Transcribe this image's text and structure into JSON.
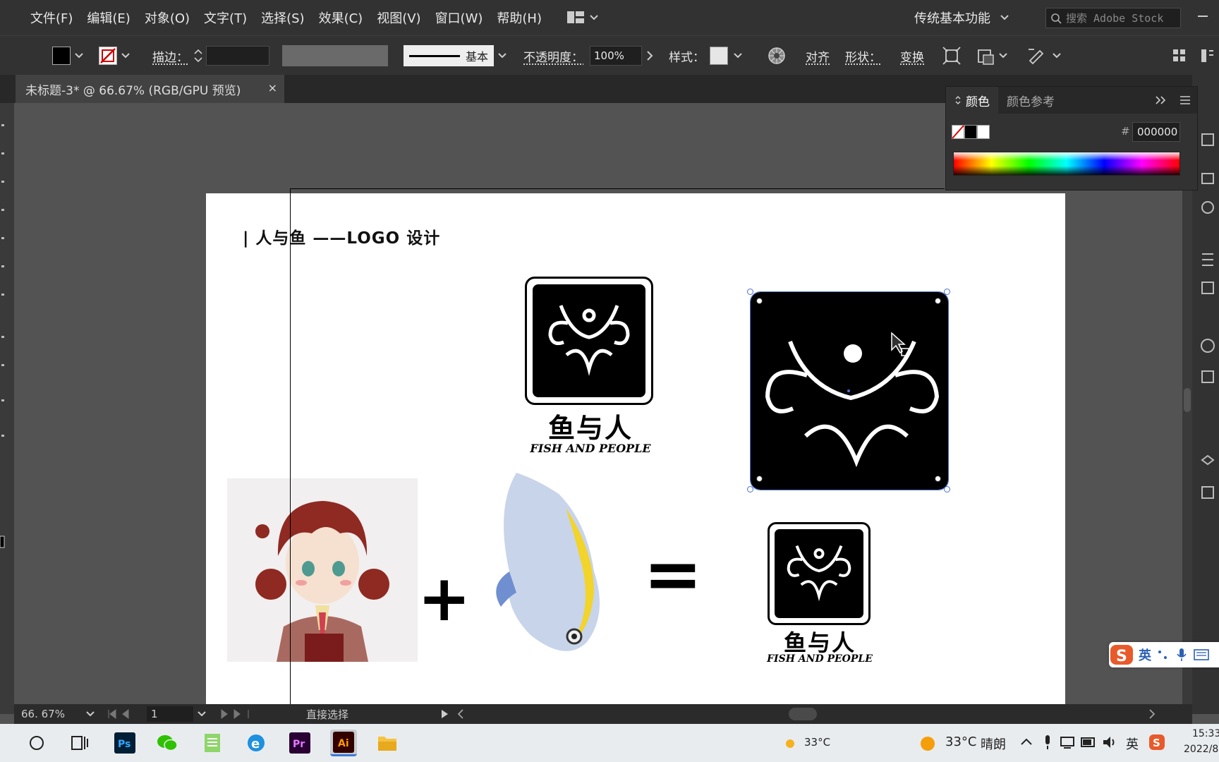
{
  "menubar": {
    "items": [
      "文件(F)",
      "编辑(E)",
      "对象(O)",
      "文字(T)",
      "选择(S)",
      "效果(C)",
      "视图(V)",
      "窗口(W)",
      "帮助(H)"
    ],
    "workspace": "传统基本功能",
    "search_placeholder": "搜索 Adobe Stock"
  },
  "controlbar": {
    "stroke_label": "描边：",
    "stroke_style": "基本",
    "opacity_label": "不透明度：",
    "opacity_value": "100%",
    "style_label": "样式：",
    "align_label": "对齐",
    "shape_label": "形状：",
    "transform_label": "变换"
  },
  "document": {
    "tab_title": "未标题-3* @ 66.67% (RGB/GPU 预览)",
    "close_glyph": "×"
  },
  "artboard": {
    "title": "| 人与鱼 ——LOGO 设计",
    "logo_cn": "鱼与人",
    "logo_en": "FISH AND PEOPLE",
    "plus": "+",
    "equals": "="
  },
  "color_panel": {
    "tab_color": "颜色",
    "tab_guide": "颜色参考",
    "hex_label": "#",
    "hex_value": "000000"
  },
  "statusbar": {
    "zoom": "66. 67%",
    "artboard_num": "1",
    "tool_name": "直接选择"
  },
  "ime": {
    "lang": "英"
  },
  "taskbar": {
    "weather_left": "33°C",
    "weather_temp": "33°C",
    "weather_text": "晴朗",
    "ime_lang": "英",
    "time": "15:33",
    "date": "2022/8"
  },
  "colors": {
    "chrome_dark": "#323232",
    "canvas": "#535353",
    "selection": "#4a6fd8"
  }
}
